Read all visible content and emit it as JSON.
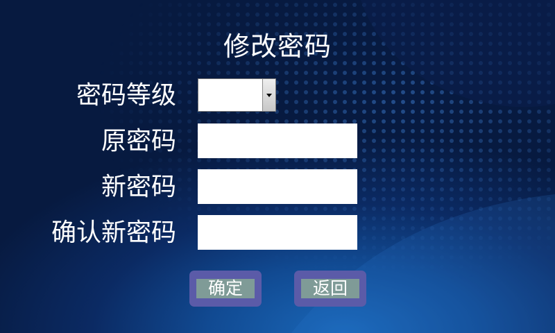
{
  "form": {
    "title": "修改密码",
    "level_label": "密码等级",
    "level_value": "",
    "old_password_label": "原密码",
    "old_password_value": "",
    "new_password_label": "新密码",
    "new_password_value": "",
    "confirm_password_label": "确认新密码",
    "confirm_password_value": ""
  },
  "buttons": {
    "confirm_label": "确定",
    "back_label": "返回"
  },
  "colors": {
    "background_dark": "#071a40",
    "background_light": "#1a67b8",
    "button_outer": "#5b5ba8",
    "button_face": "#7f9b97"
  }
}
